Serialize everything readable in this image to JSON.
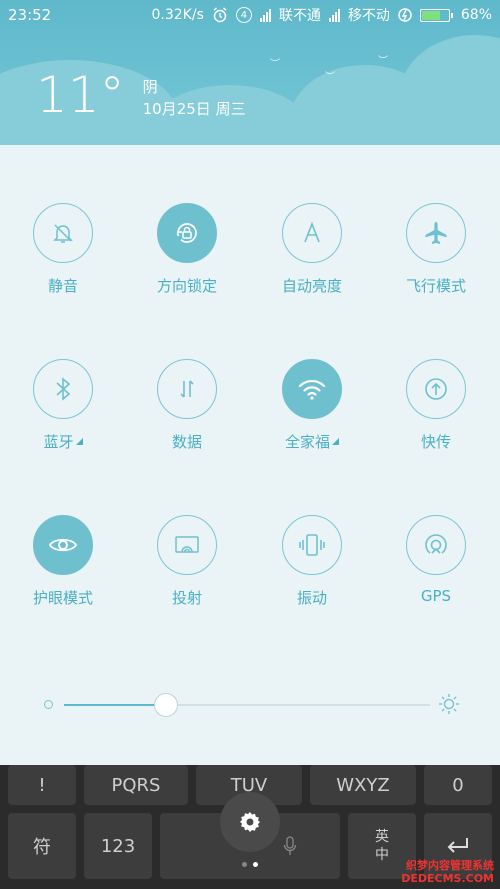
{
  "status_bar": {
    "time": "23:52",
    "speed": "0.32K/s",
    "sim_badge": "4",
    "carrier1": "联不通",
    "carrier2": "移不动",
    "battery_pct": "68%",
    "battery_level": 0.68
  },
  "weather": {
    "temperature": "11°",
    "condition": "阴",
    "date": "10月25日 周三"
  },
  "tiles": [
    {
      "id": "mute",
      "label": "静音",
      "icon": "bell-off-icon",
      "on": false
    },
    {
      "id": "rotation-lock",
      "label": "方向锁定",
      "icon": "rotation-lock-icon",
      "on": true
    },
    {
      "id": "auto-brightness",
      "label": "自动亮度",
      "icon": "auto-brightness-icon",
      "on": false
    },
    {
      "id": "airplane",
      "label": "飞行模式",
      "icon": "airplane-icon",
      "on": false
    },
    {
      "id": "bluetooth",
      "label": "蓝牙",
      "icon": "bluetooth-icon",
      "on": false,
      "expand": true
    },
    {
      "id": "data",
      "label": "数据",
      "icon": "data-arrows-icon",
      "on": false
    },
    {
      "id": "wifi",
      "label": "全家福",
      "icon": "wifi-icon",
      "on": true,
      "expand": true
    },
    {
      "id": "quick-share",
      "label": "快传",
      "icon": "quick-share-icon",
      "on": false
    },
    {
      "id": "eye-care",
      "label": "护眼模式",
      "icon": "eye-icon",
      "on": true
    },
    {
      "id": "cast",
      "label": "投射",
      "icon": "cast-icon",
      "on": false
    },
    {
      "id": "vibrate",
      "label": "振动",
      "icon": "vibrate-icon",
      "on": false
    },
    {
      "id": "gps",
      "label": "GPS",
      "icon": "gps-icon",
      "on": false
    }
  ],
  "brightness": {
    "level": 0.28
  },
  "keyboard": {
    "row1": [
      "!",
      "PQRS",
      "TUV",
      "WXYZ",
      "0"
    ],
    "row2": [
      "符",
      "123",
      "",
      "英\n中",
      ""
    ]
  },
  "colors": {
    "accent": "#6fc0cf",
    "header": "#5fb9cb",
    "panel": "#eaf3f5"
  },
  "watermark": {
    "line1": "织梦内容管理系统",
    "line2": "DEDECMS.COM"
  }
}
